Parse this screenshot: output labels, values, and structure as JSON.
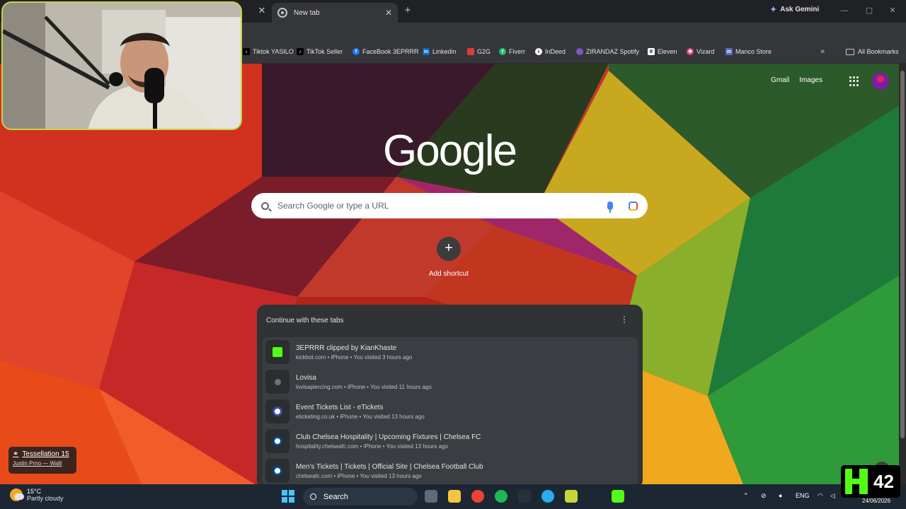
{
  "browser": {
    "active_tab_title": "New tab",
    "gemini_label": "Ask Gemini"
  },
  "bookmarks": [
    {
      "label": "Tiktok YASILO",
      "icon": "tiktok-icon",
      "color": "#000000"
    },
    {
      "label": "TikTok Seller",
      "icon": "tiktok-icon",
      "color": "#000000"
    },
    {
      "label": "FaceBook 3EPRRR",
      "icon": "facebook-icon",
      "color": "#1877f2"
    },
    {
      "label": "Linkedin",
      "icon": "linkedin-icon",
      "color": "#0a66c2"
    },
    {
      "label": "G2G",
      "icon": "g2g-icon",
      "color": "#e53935"
    },
    {
      "label": "Fiverr",
      "icon": "fiverr-icon",
      "color": "#1dbf73"
    },
    {
      "label": "InDeed",
      "icon": "indeed-icon",
      "color": "#ffffff"
    },
    {
      "label": "ZIRANDAZ Spotify",
      "icon": "spotify-icon",
      "color": "#7e57c2"
    },
    {
      "label": "Eleven",
      "icon": "elevenlabs-icon",
      "color": "#ffffff"
    },
    {
      "label": "Vizard",
      "icon": "vizard-icon",
      "color": "#ec407a"
    },
    {
      "label": "Manco Store",
      "icon": "store-icon",
      "color": "#5c6bc0"
    }
  ],
  "all_bookmarks_label": "All Bookmarks",
  "ntp": {
    "gmail_label": "Gmail",
    "images_label": "Images",
    "logo_text": "Google",
    "search_placeholder": "Search Google or type a URL",
    "add_shortcut_label": "Add shortcut",
    "continue_header": "Continue with these tabs",
    "tabs": [
      {
        "title": "3EPRRR clipped by KianKhaste",
        "meta": "kickbot.com • iPhone • You visited 3 hours ago",
        "icon_color": "#53fc18"
      },
      {
        "title": "Lovisa",
        "meta": "lovisapiercing.com • iPhone • You visited 11 hours ago",
        "icon_color": "#9aa0a6"
      },
      {
        "title": "Event Tickets List - eTickets",
        "meta": "eticketing.co.uk • iPhone • You visited 13 hours ago",
        "icon_color": "#3949ab"
      },
      {
        "title": "Club Chelsea Hospitality | Upcoming Fixtures | Chelsea FC",
        "meta": "hospitality.chelseafc.com • iPhone • You visited 13 hours ago",
        "icon_color": "#034694"
      },
      {
        "title": "Men's Tickets | Tickets | Official Site | Chelsea Football Club",
        "meta": "chelseafc.com • iPhone • You visited 13 hours ago",
        "icon_color": "#034694"
      }
    ]
  },
  "now_playing": {
    "track": "Tessellation 15",
    "artist": "Justin Prno — Walli"
  },
  "taskbar": {
    "temperature": "15°C",
    "condition": "Partly cloudy",
    "search_label": "Search",
    "language": "ENG",
    "date": "24/06/2026"
  },
  "overlay": {
    "kick_count": "42"
  }
}
